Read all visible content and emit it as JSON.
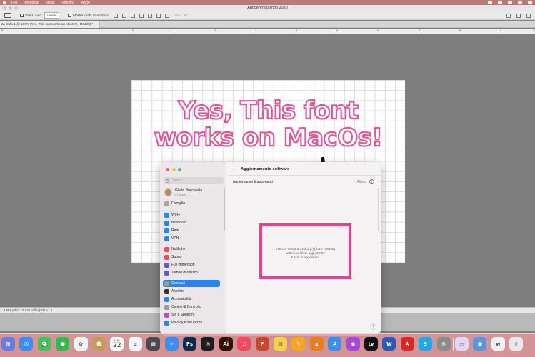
{
  "menubar": {
    "items": [
      "File",
      "Modifica",
      "Vista",
      "Finestra",
      "Aiuto"
    ]
  },
  "window": {
    "title": "Adobe Photoshop 2020"
  },
  "options": {
    "autoselect": "Selez. auto:",
    "layer": "Livello",
    "transform": "Mostra contr. trasformaz.",
    "mode3d": "Mod. 3D:"
  },
  "document": {
    "tab": "za titolo-1 @ 100% (Yes, This font works on MacOs! , RGB/8) *",
    "headline_line1": "Yes, This font",
    "headline_line2": "works on MacOs!"
  },
  "ruler": {
    "labels": [
      "5",
      "0",
      "1",
      "2",
      "3",
      "4",
      "5",
      "6",
      "7",
      "8",
      "9",
      "1"
    ]
  },
  "statusbar": {
    "text": "8,667 pollici x 5,833 pollici (300 p... )"
  },
  "settings": {
    "search_placeholder": "Cerca",
    "user_name": "Giada Buccarella",
    "user_sub": "ID Apple",
    "items": [
      {
        "label": "Famiglia",
        "color": "#a7a2a4"
      },
      {
        "label": "Wi-Fi",
        "color": "#2a84ef"
      },
      {
        "label": "Bluetooth",
        "color": "#2a84ef"
      },
      {
        "label": "Rete",
        "color": "#2a84ef"
      },
      {
        "label": "VPN",
        "color": "#2a84ef"
      },
      {
        "label": "Notifiche",
        "color": "#eb4d5c"
      },
      {
        "label": "Suono",
        "color": "#eb4d5c"
      },
      {
        "label": "Full immersion",
        "color": "#6a55d8"
      },
      {
        "label": "Tempo di utilizzo",
        "color": "#6a55d8"
      },
      {
        "label": "Generali",
        "color": "#9c989a"
      },
      {
        "label": "Aspetto",
        "color": "#333333"
      },
      {
        "label": "Accessibilità",
        "color": "#2a84ef"
      },
      {
        "label": "Centro di Controllo",
        "color": "#9c989a"
      },
      {
        "label": "Siri e Spotlight",
        "color": "#c04ad8"
      },
      {
        "label": "Privacy e sicurezza",
        "color": "#2a84ef"
      }
    ],
    "active_label": "Generali",
    "page_title": "Aggiornamento software",
    "auto_updates_label": "Aggiornamenti automatici",
    "auto_updates_value": "Attivo",
    "os_version": "macOS Ventura 13.4.1 (c) (22F770820d)",
    "last_check": "Ultima verifica: oggi, 02:07",
    "status": "Il Mac è aggiornato",
    "help": "?"
  },
  "dock": {
    "calendar_month": "LUG",
    "calendar_day": "22",
    "apps": [
      {
        "name": "launchpad-icon",
        "color": "#6a7bd8",
        "glyph": "⊞"
      },
      {
        "name": "mail-icon",
        "color": "#3c8df1",
        "glyph": "✉"
      },
      {
        "name": "messages-icon",
        "color": "#3fc45a",
        "glyph": "💬"
      },
      {
        "name": "facetime-icon",
        "color": "#35b84d",
        "glyph": "■"
      },
      {
        "name": "photos-icon",
        "color": "#f2f2f2",
        "glyph": "✿"
      },
      {
        "name": "contacts-icon",
        "color": "#c79a5c",
        "glyph": "☻"
      },
      {
        "name": "reminders-icon",
        "color": "#f6f6f6",
        "glyph": "≡"
      },
      {
        "name": "calculator-icon",
        "color": "#4a4a4a",
        "glyph": "▦"
      },
      {
        "name": "safari-icon",
        "color": "#3c8df1",
        "glyph": "✧"
      },
      {
        "name": "photoshop-icon",
        "color": "#0d2b4a",
        "glyph": "Ps"
      },
      {
        "name": "creative-cloud-icon",
        "color": "#1d1d1d",
        "glyph": "◎"
      },
      {
        "name": "illustrator-icon",
        "color": "#331300",
        "glyph": "Ai"
      },
      {
        "name": "music-icon",
        "color": "#f24a63",
        "glyph": "♫"
      },
      {
        "name": "powerpoint-icon",
        "color": "#c8472b",
        "glyph": "P"
      },
      {
        "name": "notes-icon",
        "color": "#f7d04a",
        "glyph": "▤"
      },
      {
        "name": "pencil-icon",
        "color": "#f5a623",
        "glyph": "✎"
      },
      {
        "name": "vlc-icon",
        "color": "#f07b1a",
        "glyph": "▲"
      },
      {
        "name": "appstore-icon",
        "color": "#3c8df1",
        "glyph": "A"
      },
      {
        "name": "podcasts-icon",
        "color": "#a44ad8",
        "glyph": "◉"
      },
      {
        "name": "appletv-icon",
        "color": "#111111",
        "glyph": "tv"
      },
      {
        "name": "word-icon",
        "color": "#2b5bb8",
        "glyph": "W"
      },
      {
        "name": "acrobat-icon",
        "color": "#d42a1f",
        "glyph": "⅄"
      },
      {
        "name": "skype-icon",
        "color": "#23a7e8",
        "glyph": "S"
      },
      {
        "name": "system-settings-icon",
        "color": "#8c8c8c",
        "glyph": "⚙"
      },
      {
        "name": "preview-icon",
        "color": "#e0d8ef",
        "glyph": "▭"
      },
      {
        "name": "finder-window-icon",
        "color": "#5c93e0",
        "glyph": "▣"
      },
      {
        "name": "webex-icon",
        "color": "#f0f0f0",
        "glyph": "w"
      },
      {
        "name": "trash-icon",
        "color": "#e9e9e9",
        "glyph": "▯"
      }
    ]
  }
}
